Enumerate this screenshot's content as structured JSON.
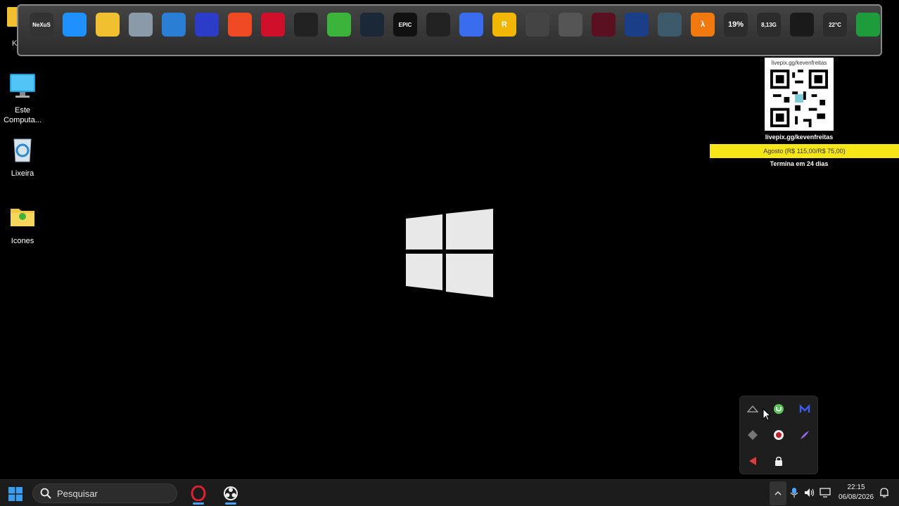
{
  "desktop": {
    "partial_label": "Ke",
    "icons": [
      {
        "label": "Este Computa..."
      },
      {
        "label": "Lixeira"
      },
      {
        "label": "Icones"
      }
    ]
  },
  "dock": {
    "items": [
      {
        "name": "nexus-icon",
        "text": "NeXuS",
        "color": "#333333"
      },
      {
        "name": "windows-icon",
        "text": "",
        "color": "#1e90ff"
      },
      {
        "name": "folder-icon",
        "text": "",
        "color": "#f0c030"
      },
      {
        "name": "recycle-bin-icon",
        "text": "",
        "color": "#8a9aa8"
      },
      {
        "name": "remote-desktop-icon",
        "text": "",
        "color": "#2a7fd4"
      },
      {
        "name": "malwarebytes-icon",
        "text": "",
        "color": "#2a3cc8"
      },
      {
        "name": "brave-icon",
        "text": "",
        "color": "#f04a24"
      },
      {
        "name": "opera-icon",
        "text": "",
        "color": "#d0102a"
      },
      {
        "name": "obs-icon",
        "text": "",
        "color": "#222222"
      },
      {
        "name": "utorrent-icon",
        "text": "",
        "color": "#3cb43c"
      },
      {
        "name": "steam-icon",
        "text": "",
        "color": "#1b2838"
      },
      {
        "name": "epic-games-icon",
        "text": "EPIC",
        "color": "#111111"
      },
      {
        "name": "roblox-icon",
        "text": "",
        "color": "#222222"
      },
      {
        "name": "roblox-studio-icon",
        "text": "",
        "color": "#3a6cf0"
      },
      {
        "name": "rockstar-icon",
        "text": "R",
        "color": "#f2b705"
      },
      {
        "name": "gta-icon",
        "text": "",
        "color": "#444444"
      },
      {
        "name": "fallout-icon",
        "text": "",
        "color": "#555555"
      },
      {
        "name": "eye-app-icon",
        "text": "",
        "color": "#5a1020"
      },
      {
        "name": "network-app-icon",
        "text": "",
        "color": "#1a3f88"
      },
      {
        "name": "game-cover-icon",
        "text": "",
        "color": "#3c5a6c"
      },
      {
        "name": "half-life-icon",
        "text": "λ",
        "color": "#f07a10"
      },
      {
        "name": "cpu-meter-icon",
        "text": "19%",
        "color": "#2c2c2c"
      },
      {
        "name": "ram-meter-icon",
        "text": "8,13G",
        "color": "#2c2c2c"
      },
      {
        "name": "camera-icon",
        "text": "",
        "color": "#1a1a1a"
      },
      {
        "name": "weather-icon",
        "text": "22°C",
        "color": "#2c2c2c"
      },
      {
        "name": "power-icon",
        "text": "",
        "color": "#1e9c3c"
      }
    ]
  },
  "widget": {
    "url_top": "livepix.gg/kevenfreitas",
    "url_bottom": "livepix.gg/kevenfreitas",
    "goal": "Agosto (R$ 115,00/R$ 75,00)",
    "ends": "Termina em 24 dias"
  },
  "taskbar": {
    "search_placeholder": "Pesquisar",
    "time": "22:15",
    "date": "06/08/2026"
  },
  "colors": {
    "goal_bar": "#f7e617",
    "taskbar": "#1c1c1c",
    "accent": "#4aa3ff"
  }
}
